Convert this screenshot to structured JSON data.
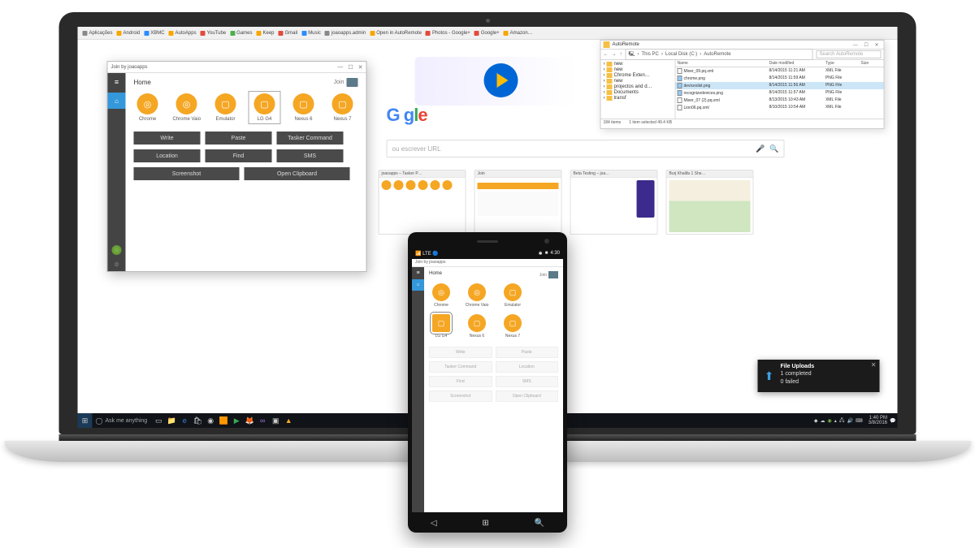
{
  "bookmarks": [
    {
      "label": "Aplicações",
      "cls": "d"
    },
    {
      "label": "Android",
      "cls": ""
    },
    {
      "label": "XBMC",
      "cls": "b"
    },
    {
      "label": "AutoApps",
      "cls": ""
    },
    {
      "label": "YouTube",
      "cls": "a"
    },
    {
      "label": "Games",
      "cls": "c"
    },
    {
      "label": "Keep",
      "cls": ""
    },
    {
      "label": "Gmail",
      "cls": "a"
    },
    {
      "label": "Music",
      "cls": "b"
    },
    {
      "label": "joaoapps.admin",
      "cls": "d"
    },
    {
      "label": "Open in AutoRemote",
      "cls": ""
    },
    {
      "label": "Photos - Google+",
      "cls": "a"
    },
    {
      "label": "Google+",
      "cls": "a"
    },
    {
      "label": "Amazon…",
      "cls": ""
    }
  ],
  "search_placeholder": "ou escrever URL",
  "thumbs": [
    {
      "title": "joaoapps – Tasker P…",
      "kind": "devs"
    },
    {
      "title": "Join",
      "kind": "join"
    },
    {
      "title": "Beta Testing – joa…",
      "kind": "beta"
    },
    {
      "title": "Burj Khalifa 1 She…",
      "kind": "map"
    }
  ],
  "join_win": {
    "title": "Join by joaoapps",
    "home": "Home",
    "join_label": "Join",
    "devices": [
      {
        "label": "Chrome",
        "glyph": "◎"
      },
      {
        "label": "Chrome Vaio",
        "glyph": "◎"
      },
      {
        "label": "Emulator",
        "glyph": "▢"
      },
      {
        "label": "LG G4",
        "glyph": "▢",
        "selected": true
      },
      {
        "label": "Nexus 6",
        "glyph": "▢"
      },
      {
        "label": "Nexus 7",
        "glyph": "▢"
      }
    ],
    "actions_row1": [
      "Write",
      "Paste",
      "Tasker Command"
    ],
    "actions_row2": [
      "Location",
      "Find",
      "SMS"
    ],
    "actions_row3": [
      "Screenshot",
      "Open Clipboard"
    ]
  },
  "explorer": {
    "title": "AutoRemote",
    "path": [
      "This PC",
      "Local Disk (C:)",
      "AutoRemote"
    ],
    "search_placeholder": "Search AutoRemote",
    "tree": [
      "new",
      "new",
      "Chrome Exten…",
      "new",
      "projectos and d…",
      "Documents",
      "transf"
    ],
    "columns": [
      "Name",
      "Date modified",
      "Type",
      "Size"
    ],
    "rows": [
      {
        "name": "Mixer_09.pq.xml",
        "date": "8/14/2015 11:21 AM",
        "type": "XML File",
        "size": ""
      },
      {
        "name": "chrome.png",
        "date": "8/14/2015 11:59 AM",
        "type": "PNG File",
        "size": ""
      },
      {
        "name": "deviceslist.png",
        "date": "8/14/2015 11:56 AM",
        "type": "PNG File",
        "size": "",
        "selected": true
      },
      {
        "name": "recognizedevices.png",
        "date": "8/14/2015 11:57 AM",
        "type": "PNG File",
        "size": ""
      },
      {
        "name": "Mixer_07 (2).pq.xml",
        "date": "8/13/2015 10:43 AM",
        "type": "XML File",
        "size": ""
      },
      {
        "name": "Lion06.pq.xml",
        "date": "8/10/2015 10:54 AM",
        "type": "XML File",
        "size": ""
      }
    ],
    "status": {
      "items": "184 items",
      "sel": "1 item selected  49.4 KB"
    }
  },
  "toast": {
    "title": "File Uploads",
    "line1": "1 completed",
    "line2": "0 failed"
  },
  "taskbar": {
    "search": "Ask me anything",
    "time": "1:40 PM",
    "date": "3/8/2016"
  },
  "phone": {
    "status": {
      "net": "📶",
      "carrier": "LTE",
      "ico": "🔵",
      "bt": "✱",
      "batt": "■",
      "time": "4:30"
    },
    "title": "Join by joaoapps",
    "home": "Home",
    "join_label": "Join",
    "devices": [
      {
        "label": "Chrome",
        "glyph": "◎"
      },
      {
        "label": "Chrome Vaio",
        "glyph": "◎"
      },
      {
        "label": "Emulator",
        "glyph": "▢"
      },
      {
        "label": "LG G4",
        "glyph": "▢",
        "selected": true
      },
      {
        "label": "Nexus 6",
        "glyph": "▢"
      },
      {
        "label": "Nexus 7",
        "glyph": "▢"
      }
    ],
    "actions": [
      "Write",
      "Paste",
      "Tasker Command",
      "Location",
      "Find",
      "SMS",
      "Screenshot",
      "Open Clipboard"
    ]
  }
}
